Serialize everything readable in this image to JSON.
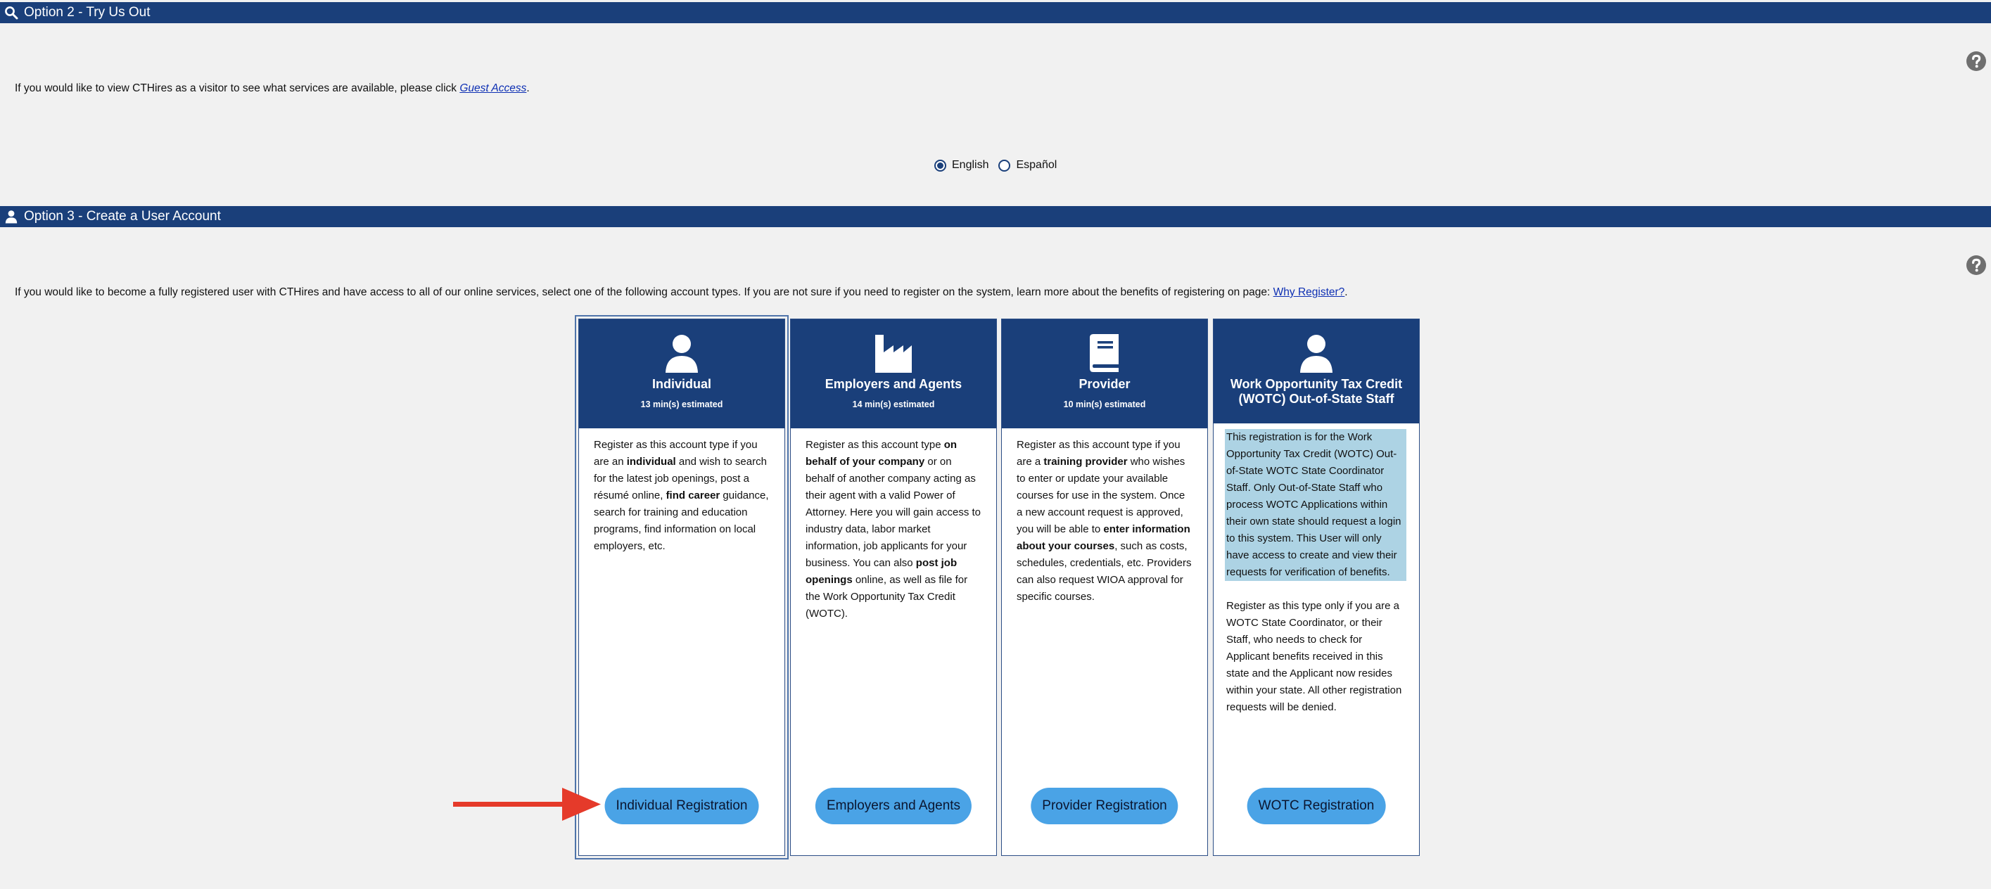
{
  "option2": {
    "title": "Option 2 - Try Us Out",
    "intro_text": "If you would like to view CTHires as a visitor to see what services are available, please click ",
    "link": "Guest Access",
    "intro_end": ".",
    "languages": [
      {
        "label": "English",
        "selected": true
      },
      {
        "label": "Español",
        "selected": false
      }
    ]
  },
  "option3": {
    "title": "Option 3 - Create a User Account",
    "intro_text": "If you would like to become a fully registered user with CTHires and have access to all of our online services, select one of the following account types. If you are not sure if you need to register on the system, learn more about the benefits of registering on page: ",
    "link": "Why Register?",
    "intro_end": "."
  },
  "cards": {
    "individual": {
      "title": "Individual",
      "time": "13 min(s) estimated",
      "t1": "Register as this account type if you are an ",
      "b1": "individual",
      "t2": " and wish to search for the latest job openings, post a résumé online, ",
      "b2": "find career",
      "t3": " guidance, search for training and education programs, find information on local employers, etc.",
      "button": "Individual Registration"
    },
    "employers": {
      "title": "Employers and Agents",
      "time": "14 min(s) estimated",
      "t1": "Register as this account type ",
      "b1": "on behalf of your company",
      "t2": " or on behalf of another company acting as their agent with a valid Power of Attorney. Here you will gain access to industry data, labor market information, job applicants for your business. You can also ",
      "b2": "post job openings",
      "t3": " online, as well as file for the Work Opportunity Tax Credit (WOTC).",
      "button": "Employers and Agents"
    },
    "provider": {
      "title": "Provider",
      "time": "10 min(s) estimated",
      "t1": "Register as this account type if you are a ",
      "b1": "training provider",
      "t2": " who wishes to enter or update your available courses for use in the system. Once a new account request is approved, you will be able to ",
      "b2": "enter information about your courses",
      "t3": ", such as costs, schedules, credentials, etc. Providers can also request WIOA approval for specific courses.",
      "button": "Provider Registration"
    },
    "wotc": {
      "title": "Work Opportunity Tax Credit (WOTC) Out-of-State Staff",
      "p1": "This registration is for the Work Opportunity Tax Credit (WOTC) Out-of-State WOTC State Coordinator Staff. Only Out-of-State Staff who process WOTC Applications within their own state should request a login to this system. This User will only have access to create and view their requests for verification of benefits.",
      "p2": "Register as this type only if you are a WOTC State Coordinator, or their Staff, who needs to check for Applicant benefits received in this state and the Applicant now resides within your state. All other registration requests will be denied.",
      "button": "WOTC Registration"
    }
  },
  "icons": {
    "option2": "search-icon",
    "option3": "user-icon",
    "help": "question-circle-icon",
    "individual": "person-icon",
    "employers": "factory-icon",
    "provider": "book-icon",
    "wotc": "person-icon",
    "pointer": "red-arrow-icon"
  },
  "colors": {
    "bar": "#1a3f7a",
    "button": "#4aa3e6",
    "highlight": "#add3e4",
    "arrow": "#e53a2a"
  }
}
